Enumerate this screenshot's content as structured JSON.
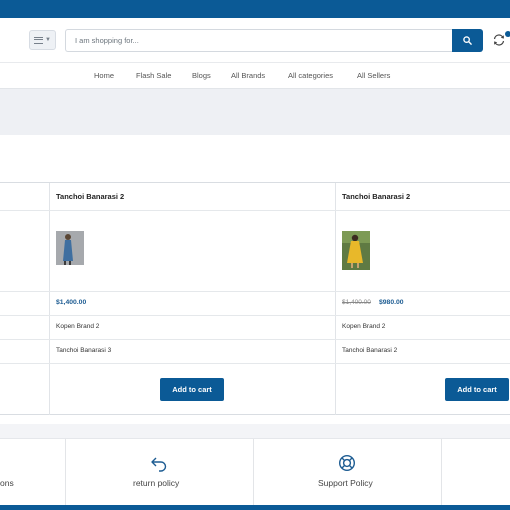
{
  "search": {
    "placeholder": "I am shopping for..."
  },
  "nav": {
    "items": [
      {
        "label": "Home"
      },
      {
        "label": "Flash Sale"
      },
      {
        "label": "Blogs"
      },
      {
        "label": "All Brands"
      },
      {
        "label": "All categories"
      },
      {
        "label": "All Sellers"
      }
    ]
  },
  "compare": {
    "products": [
      {
        "name": "Tanchoi Banarasi 2",
        "price": "$1,400.00",
        "old_price": "",
        "brand": "Kopen Brand 2",
        "related": "Tanchoi Banarasi 3",
        "add_to_cart": "Add to cart",
        "image_colors": {
          "dress": "#3f6fa0",
          "background": "#a6a9ad"
        }
      },
      {
        "name": "Tanchoi Banarasi 2",
        "price": "$980.00",
        "old_price": "$1,400.00",
        "brand": "Kopen Brand 2",
        "related": "Tanchoi Banarasi 2",
        "add_to_cart": "Add to cart",
        "image_colors": {
          "dress": "#e8b82a",
          "background": "#5f7a43"
        }
      }
    ]
  },
  "policies": {
    "items": [
      {
        "label": "ons",
        "icon": ""
      },
      {
        "label": "return policy",
        "icon": "return-arrow-icon"
      },
      {
        "label": "Support Policy",
        "icon": "lifebuoy-icon"
      },
      {
        "label": "",
        "icon": ""
      }
    ]
  },
  "colors": {
    "primary": "#0b5a96",
    "price": "#1d5c92",
    "banner": "#eef0f4"
  }
}
